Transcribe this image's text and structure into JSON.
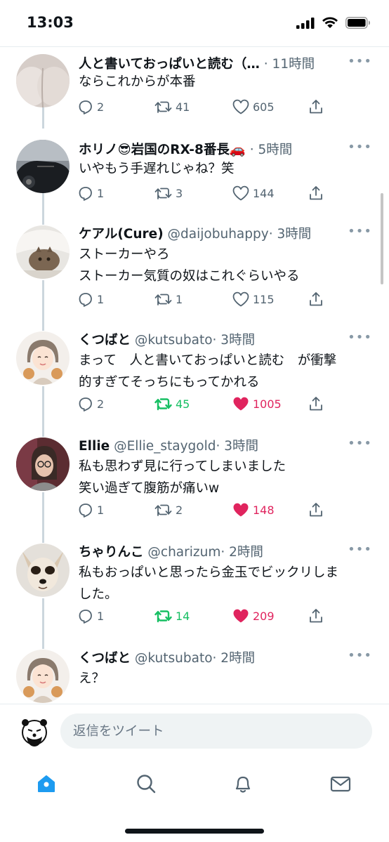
{
  "status_bar": {
    "time": "13:03"
  },
  "tweets": [
    {
      "name": "人と書いておっぱいと読む（…",
      "handle": "",
      "time": "· 11時間",
      "text": "ならこれからが本番",
      "replies": "2",
      "retweets": "41",
      "likes": "605",
      "retweeted": false,
      "liked": false
    },
    {
      "name": "ホリノ😎岩国のRX-8番長🚗",
      "handle": "",
      "time": "· 5時間",
      "text": "いやもう手遅れじゃね？笑",
      "replies": "1",
      "retweets": "3",
      "likes": "144",
      "retweeted": false,
      "liked": false
    },
    {
      "name": "ケアル(Cure)",
      "handle": "@daijobuhappy",
      "time": "· 3時間",
      "text": "ストーカーやろ\nストーカー気質の奴はこれぐらいやる",
      "replies": "1",
      "retweets": "1",
      "likes": "115",
      "retweeted": false,
      "liked": false
    },
    {
      "name": "くつばと",
      "handle": "@kutsubato",
      "time": "· 3時間",
      "text": "まって　人と書いておっぱいと読む　が衝撃\n的すぎてそっちにもってかれる",
      "replies": "2",
      "retweets": "45",
      "likes": "1005",
      "retweeted": true,
      "liked": true
    },
    {
      "name": "Ellie",
      "handle": "@Ellie_staygold",
      "time": "· 3時間",
      "text": "私も思わず見に行ってしまいました\n笑い過ぎて腹筋が痛いw",
      "replies": "1",
      "retweets": "2",
      "likes": "148",
      "retweeted": false,
      "liked": true
    },
    {
      "name": "ちゃりんこ",
      "handle": "@charizum",
      "time": "· 2時間",
      "text": "私もおっぱいと思ったら金玉でビックリしま\nした。",
      "replies": "1",
      "retweets": "14",
      "likes": "209",
      "retweeted": true,
      "liked": true
    },
    {
      "name": "くつばと",
      "handle": "@kutsubato",
      "time": "· 2時間",
      "text": "え？",
      "replies": "",
      "retweets": "",
      "likes": "",
      "retweeted": false,
      "liked": false
    }
  ],
  "reply": {
    "placeholder": "返信をツイート"
  },
  "tabs": {
    "active_color": "#1d9bf0",
    "icons": [
      "home-icon",
      "search-icon",
      "notifications-icon",
      "messages-icon"
    ]
  },
  "colors": {
    "retweet_active": "#17bf63",
    "like_active": "#e0245e",
    "muted": "#536471"
  }
}
